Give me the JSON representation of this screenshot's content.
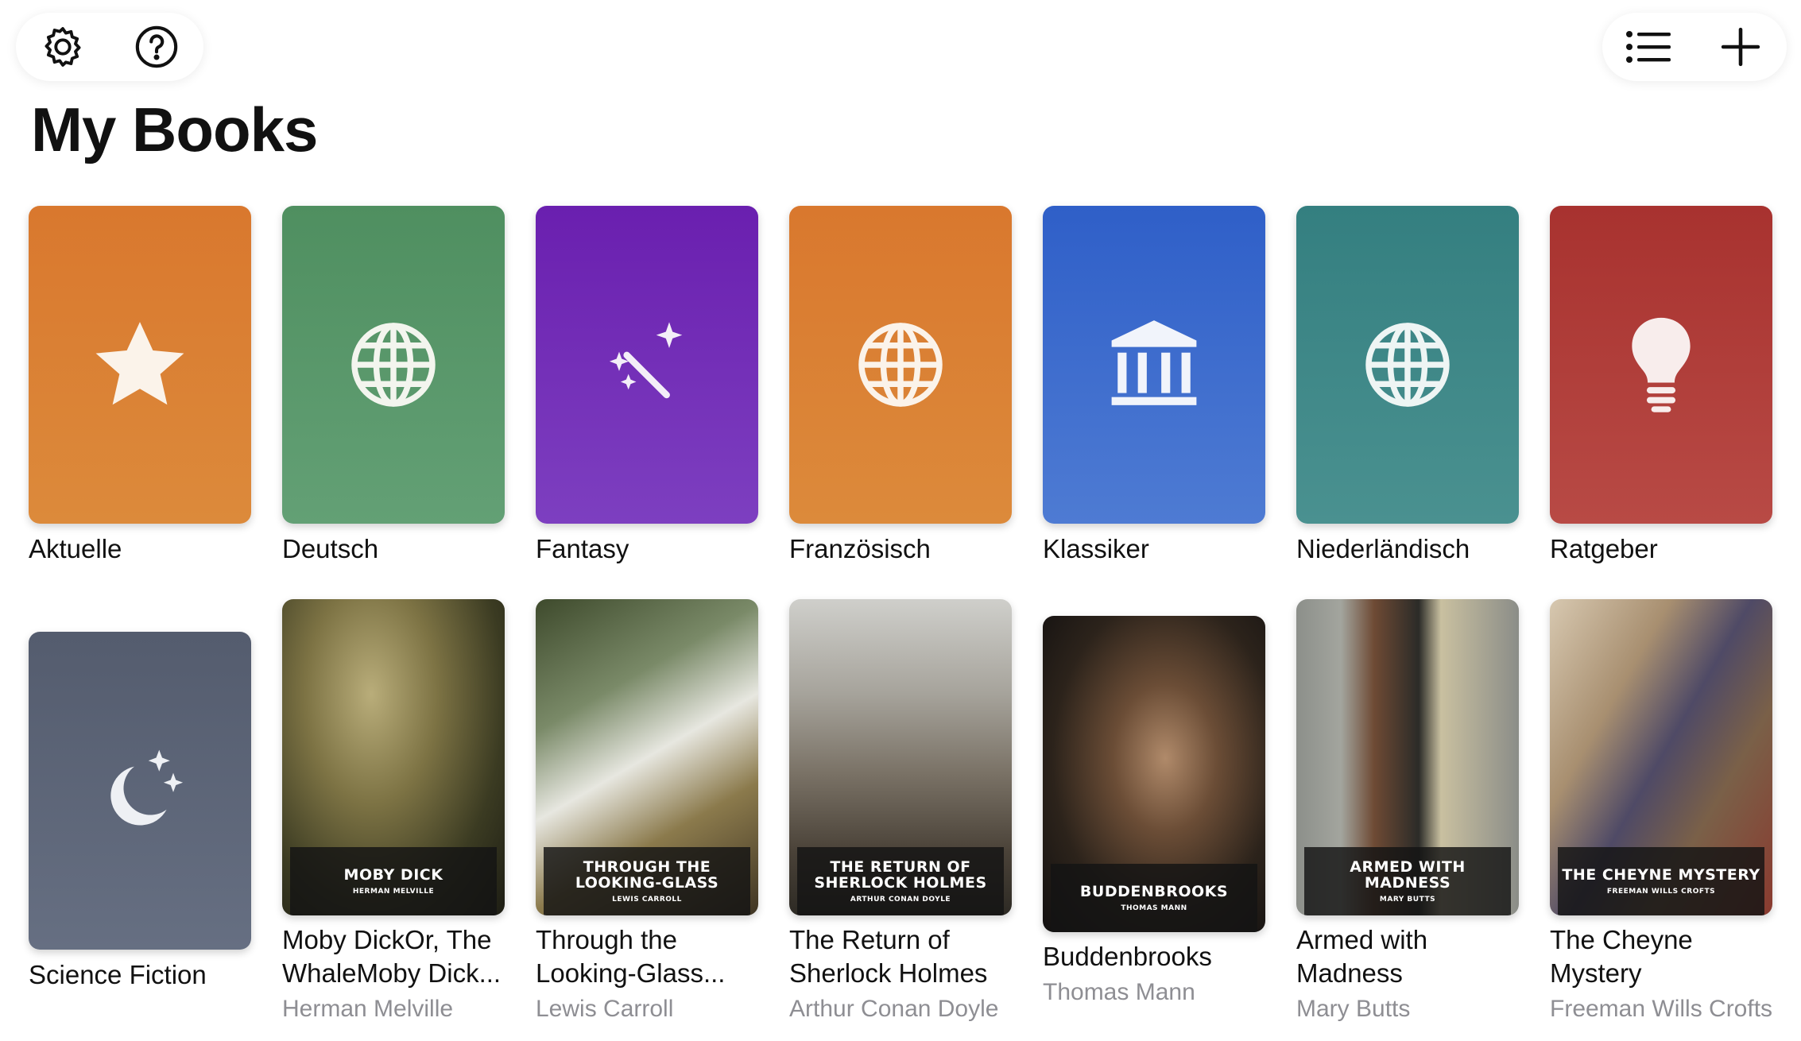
{
  "toolbar": {
    "settings_icon": "gear-icon",
    "help_icon": "question-circle-icon",
    "list_icon": "list-icon",
    "add_icon": "plus-icon"
  },
  "page_title": "My Books",
  "categories": [
    {
      "label": "Aktuelle",
      "icon": "star-icon",
      "color_top": "#D9782E",
      "color_bottom": "#DC8A3B"
    },
    {
      "label": "Deutsch",
      "icon": "globe-icon",
      "color_top": "#4F8F60",
      "color_bottom": "#63A075"
    },
    {
      "label": "Fantasy",
      "icon": "magic-wand-icon",
      "color_top": "#6A1FAF",
      "color_bottom": "#7D3FC0"
    },
    {
      "label": "Französisch",
      "icon": "globe-icon",
      "color_top": "#D9782E",
      "color_bottom": "#DC8A3B"
    },
    {
      "label": "Klassiker",
      "icon": "building-columns-icon",
      "color_top": "#2F5FC8",
      "color_bottom": "#4E7BD3"
    },
    {
      "label": "Niederländisch",
      "icon": "globe-icon",
      "color_top": "#347F80",
      "color_bottom": "#4A9190"
    },
    {
      "label": "Ratgeber",
      "icon": "lightbulb-icon",
      "color_top": "#A8322F",
      "color_bottom": "#B84A45"
    },
    {
      "label": "Science Fiction",
      "icon": "moon-stars-icon",
      "color_top": "#545C6E",
      "color_bottom": "#666F82"
    }
  ],
  "books": [
    {
      "title": "Moby DickOr, The WhaleMoby Dick...",
      "author": "Herman Melville",
      "cover_title": "MOBY DICK",
      "cover_author": "HERMAN MELVILLE"
    },
    {
      "title": "Through the Looking-Glass...",
      "author": "Lewis Carroll",
      "cover_title": "THROUGH THE LOOKING-GLASS",
      "cover_author": "LEWIS CARROLL"
    },
    {
      "title": "The Return of Sherlock Holmes",
      "author": "Arthur Conan Doyle",
      "cover_title": "THE RETURN OF SHERLOCK HOLMES",
      "cover_author": "ARTHUR CONAN DOYLE"
    },
    {
      "title": "Buddenbrooks",
      "author": "Thomas Mann",
      "cover_title": "BUDDENBROOKS",
      "cover_author": "THOMAS MANN"
    },
    {
      "title": "Armed with Madness",
      "author": "Mary Butts",
      "cover_title": "ARMED WITH MADNESS",
      "cover_author": "MARY BUTTS"
    },
    {
      "title": "The Cheyne Mystery",
      "author": "Freeman Wills Crofts",
      "cover_title": "THE CHEYNE MYSTERY",
      "cover_author": "FREEMAN WILLS CROFTS"
    }
  ]
}
